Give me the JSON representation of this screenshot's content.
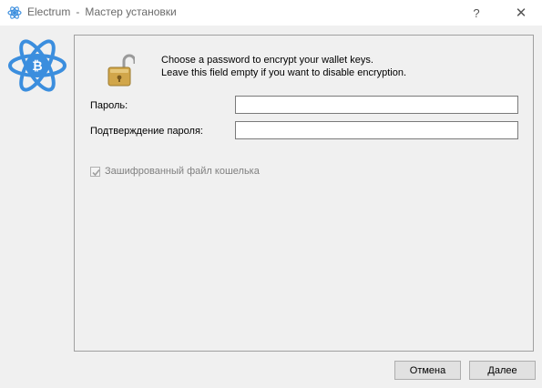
{
  "window": {
    "title_app": "Electrum",
    "title_separator": "-",
    "title_page": "Мастер установки",
    "help_label": "?",
    "close_label": "✕"
  },
  "info": {
    "line1": "Choose a password to encrypt your wallet keys.",
    "line2": "Leave this field empty if you want to disable encryption."
  },
  "form": {
    "password_label": "Пароль:",
    "password_value": "",
    "confirm_label": "Подтверждение пароля:",
    "confirm_value": "",
    "encrypt_checkbox_label": "Зашифрованный файл кошелька",
    "encrypt_checkbox_checked": true,
    "encrypt_checkbox_enabled": false
  },
  "buttons": {
    "cancel_label": "Отмена",
    "next_label": "Далее"
  },
  "colors": {
    "brand_blue": "#3b8ede",
    "lock_gold": "#d1a64a",
    "disabled_text": "#808080"
  }
}
